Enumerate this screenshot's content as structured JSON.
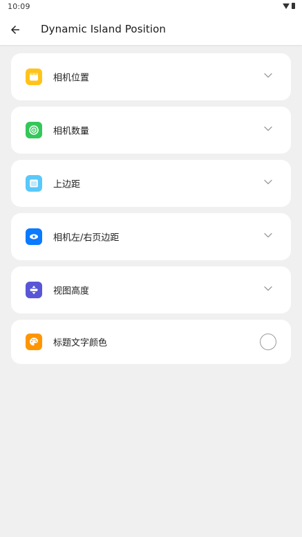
{
  "status_bar": {
    "time": "10:09",
    "icons": [
      "wifi-icon",
      "battery-icon"
    ]
  },
  "app_bar": {
    "back_icon": "arrow-left-icon",
    "title": "Dynamic Island Position"
  },
  "settings": [
    {
      "label": "相机位置",
      "icon": "camera-position-icon",
      "icon_color": "#ffc31a",
      "control": "chevron-down-icon"
    },
    {
      "label": "相机数量",
      "icon": "camera-count-icon",
      "icon_color": "#34c759",
      "control": "chevron-down-icon"
    },
    {
      "label": "上边距",
      "icon": "top-margin-icon",
      "icon_color": "#5ac8fa",
      "control": "chevron-down-icon"
    },
    {
      "label": "相机左/右页边距",
      "icon": "side-margin-icon",
      "icon_color": "#0a7aff",
      "control": "chevron-down-icon"
    },
    {
      "label": "视图高度",
      "icon": "view-height-icon",
      "icon_color": "#5856d6",
      "control": "chevron-down-icon"
    },
    {
      "label": "标题文字颜色",
      "icon": "palette-icon",
      "icon_color": "#ff9500",
      "control": "radio-unchecked"
    }
  ],
  "colors": {
    "background": "#f0f0f0",
    "card": "#ffffff",
    "chevron": "#9a9a9a"
  }
}
